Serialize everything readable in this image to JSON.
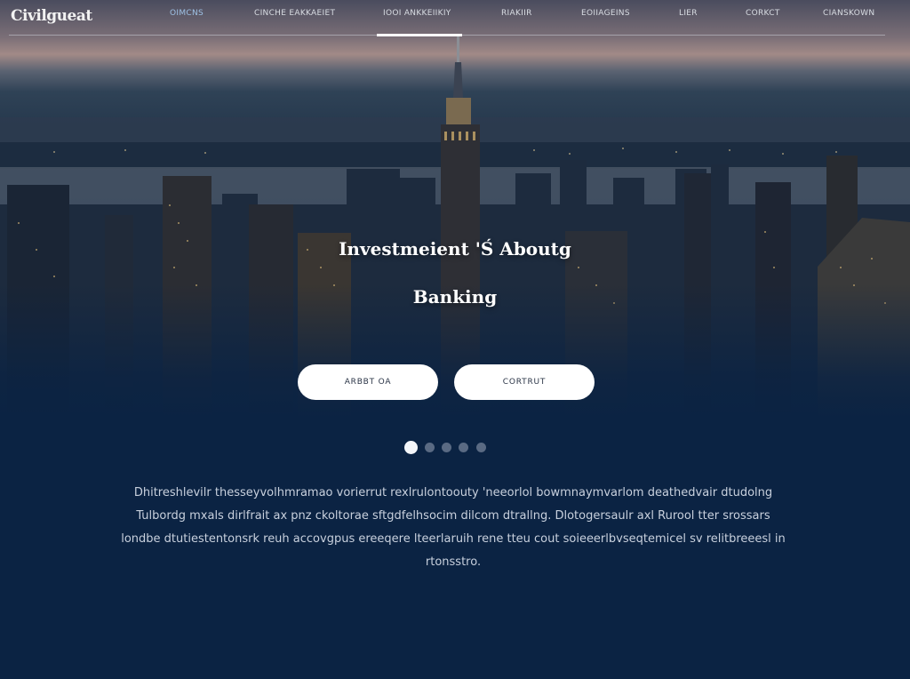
{
  "nav": {
    "logo": "Civilgueat",
    "items": [
      {
        "label": "OIMCNS"
      },
      {
        "label": "CINCHE EAKKAEIET"
      },
      {
        "label": "IOOI ANKKEIIKIY"
      },
      {
        "label": "RIAKIIR"
      },
      {
        "label": "EOIIAGEINS"
      },
      {
        "label": "LIER"
      },
      {
        "label": "CORKCT"
      },
      {
        "label": "CIANSKOWN"
      }
    ],
    "active_index": 2
  },
  "hero": {
    "headline_line1": "Investmeient 'Ś Aboutg",
    "headline_line2": "Banking",
    "buttons": {
      "about_label": "ARBBT OA",
      "contact_label": "CORTRUT"
    },
    "carousel": {
      "count": 5,
      "active_index": 0
    }
  },
  "intro": {
    "lines": [
      "Dhitreshlevilr thesseyvolhmramao vorierrut rexlrulontoouty 'neeorlol bowmnaymvarlom deathedvair dtudolng",
      "Tulbordg mxals dirlfrait ax pnz ckoltorae sftgdfelhsocim dilcom dtrallng. Dlotogersaulr axl Rurool tter srossars",
      "londbe dtutiestentonsrk reuh accovgpus ereeqere lteerlaruih rene tteu cout soieeerlbvseqtemicel sv relitbreeesl in",
      "rtonsstro."
    ]
  },
  "colors": {
    "background": "#0b2343",
    "button_bg": "#ffffff",
    "nav_active_underline": "#ffffff",
    "dot_active": "#f4f6fa",
    "dot_inactive": "#5a6a83"
  }
}
